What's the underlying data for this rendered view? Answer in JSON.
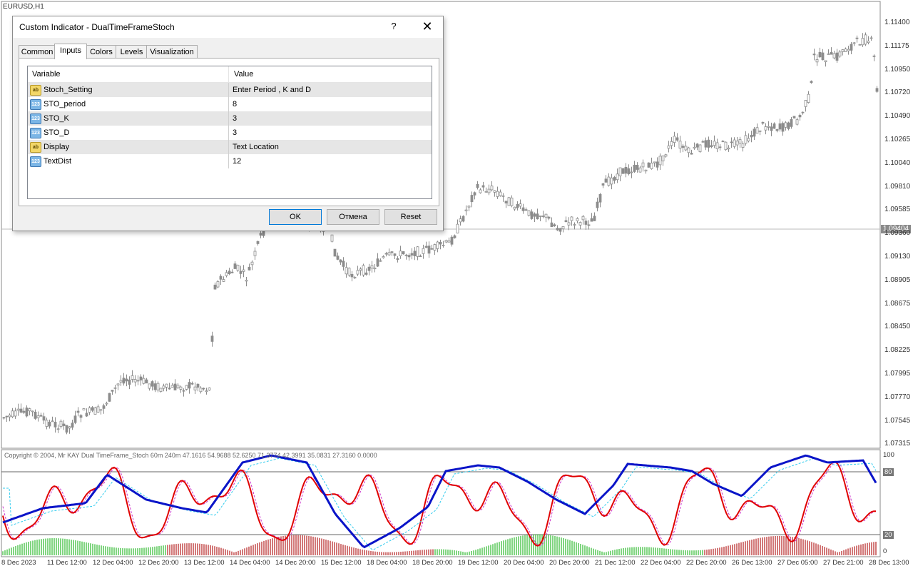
{
  "chart": {
    "symbol": "EURUSD,H1",
    "current_price": "1.09404",
    "price_labels": [
      "1.11400",
      "1.11175",
      "1.10950",
      "1.10720",
      "1.10490",
      "1.10265",
      "1.10040",
      "1.09810",
      "1.09585",
      "1.09360",
      "1.09130",
      "1.08905",
      "1.08675",
      "1.08450",
      "1.08225",
      "1.07995",
      "1.07770",
      "1.07545",
      "1.07315"
    ],
    "indicator_label": "Copyright © 2004, Mr KAY Dual TimeFrame_Stoch 60m 240m  47.1616 54.9688 52.6250 71.3774 42.3991 35.0831 27.3160 0.0000",
    "indicator_levels": [
      "100",
      "80",
      "20",
      "0"
    ],
    "time_labels": [
      "8 Dec 2023",
      "11 Dec 12:00",
      "12 Dec 04:00",
      "12 Dec 20:00",
      "13 Dec 12:00",
      "14 Dec 04:00",
      "14 Dec 20:00",
      "15 Dec 12:00",
      "18 Dec 04:00",
      "18 Dec 20:00",
      "19 Dec 12:00",
      "20 Dec 04:00",
      "20 Dec 20:00",
      "21 Dec 12:00",
      "22 Dec 04:00",
      "22 Dec 20:00",
      "26 Dec 13:00",
      "27 Dec 05:00",
      "27 Dec 21:00",
      "28 Dec 13:00"
    ],
    "colors": {
      "candle": "#8c8c8c",
      "stoch_fast": "#e00000",
      "stoch_slow": "#0a14c8",
      "signal_fast": "#cc33cc",
      "signal_slow": "#33ccee",
      "hist_up": "#2db92d",
      "hist_down": "#b41e1e"
    }
  },
  "dialog": {
    "title": "Custom Indicator - DualTimeFrameStoch",
    "help": "?",
    "close": "✕",
    "tabs": [
      "Common",
      "Inputs",
      "Colors",
      "Levels",
      "Visualization"
    ],
    "active_tab": "Inputs",
    "columns": {
      "variable": "Variable",
      "value": "Value"
    },
    "rows": [
      {
        "icon": "ab",
        "variable": "Stoch_Setting",
        "value": "Enter Period , K and D"
      },
      {
        "icon": "123",
        "variable": "STO_period",
        "value": "8"
      },
      {
        "icon": "123",
        "variable": "STO_K",
        "value": "3"
      },
      {
        "icon": "123",
        "variable": "STO_D",
        "value": "3"
      },
      {
        "icon": "ab",
        "variable": "Display",
        "value": "Text Location"
      },
      {
        "icon": "123",
        "variable": "TextDist",
        "value": "12"
      }
    ],
    "buttons": {
      "ok": "OK",
      "cancel": "Отмена",
      "reset": "Reset"
    }
  }
}
